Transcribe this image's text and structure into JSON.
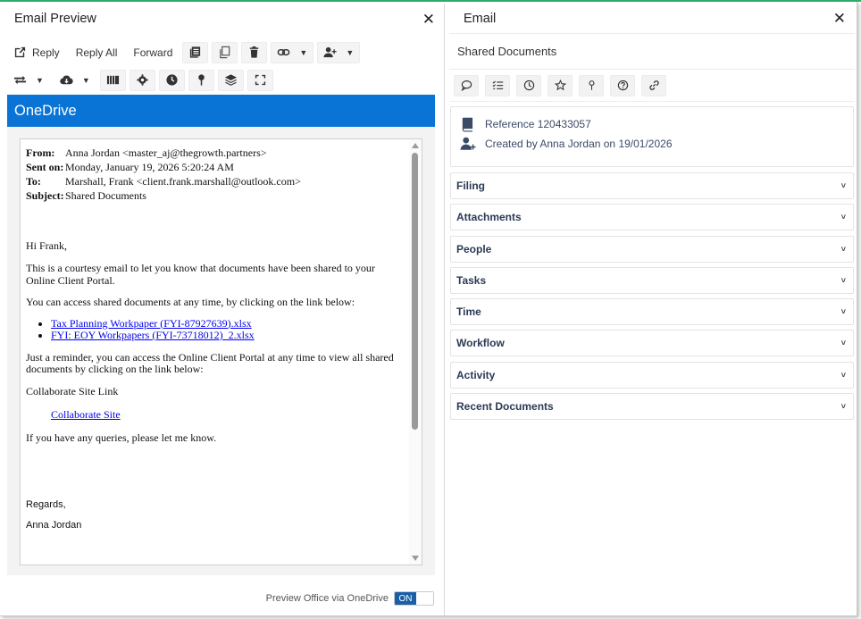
{
  "left": {
    "title": "Email Preview",
    "toolbar": {
      "reply_label": "Reply",
      "reply_all_label": "Reply All",
      "forward_label": "Forward"
    },
    "onedrive_label": "OneDrive",
    "email": {
      "headers": [
        {
          "key": "From:",
          "value": "Anna Jordan <master_aj@thegrowth.partners>"
        },
        {
          "key": "Sent on:",
          "value": "Monday, January 19, 2026 5:20:24 AM"
        },
        {
          "key": "To:",
          "value": "Marshall, Frank <client.frank.marshall@outlook.com>"
        },
        {
          "key": "Subject:",
          "value": "Shared Documents"
        }
      ],
      "greeting": "Hi Frank,",
      "para1": "This is a courtesy email to let you know that documents have been shared to your Online Client Portal.",
      "para2": "You can access shared documents at any time, by clicking on the link below:",
      "links": [
        "Tax Planning Workpaper (FYI-87927639).xlsx",
        "FYI: EOY Workpapers (FYI-73718012)_2.xlsx"
      ],
      "para3": "Just a reminder, you can access the Online Client Portal at any time to view all shared documents by clicking on the link below:",
      "collab_heading": "Collaborate Site Link",
      "collab_link": "Collaborate Site",
      "para4": "If you have any queries, please let me know.",
      "regards": "Regards,",
      "signature": "Anna Jordan"
    },
    "footer": {
      "preview_label": "Preview Office via OneDrive",
      "toggle_state": "ON"
    }
  },
  "right": {
    "title": "Email",
    "subtitle": "Shared Documents",
    "reference": "Reference 120433057",
    "created_by": "Created by Anna Jordan on 19/01/2026",
    "sections": [
      "Filing",
      "Attachments",
      "People",
      "Tasks",
      "Time",
      "Workflow",
      "Activity",
      "Recent Documents"
    ]
  },
  "colors": {
    "onedrive_blue": "#0a73d6",
    "toggle_blue": "#1a5fa8",
    "link_blue": "#0000ee",
    "top_accent": "#2fae6e"
  }
}
